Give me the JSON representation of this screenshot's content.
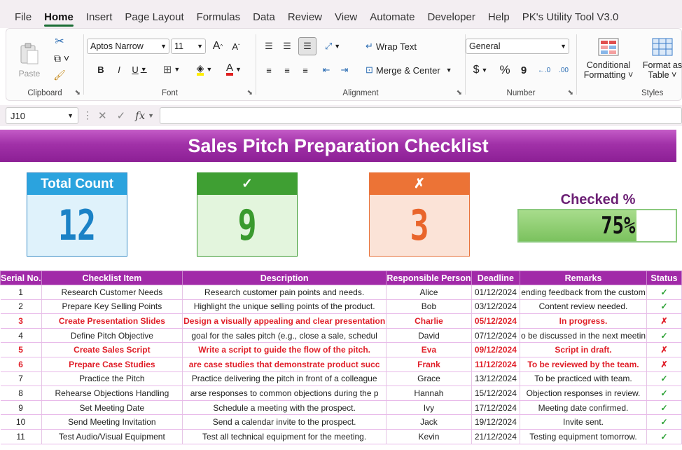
{
  "menu": {
    "tabs": [
      "File",
      "Home",
      "Insert",
      "Page Layout",
      "Formulas",
      "Data",
      "Review",
      "View",
      "Automate",
      "Developer",
      "Help",
      "PK's Utility Tool V3.0"
    ],
    "active": "Home"
  },
  "ribbon": {
    "clipboard": {
      "label": "Clipboard",
      "paste": "Paste"
    },
    "font": {
      "label": "Font",
      "name": "Aptos Narrow",
      "size": "11",
      "bold": "B",
      "italic": "I",
      "underline": "U",
      "grow": "A",
      "shrink": "A"
    },
    "alignment": {
      "label": "Alignment",
      "wrap_text": "Wrap Text",
      "merge_center": "Merge & Center"
    },
    "number": {
      "label": "Number",
      "format": "General",
      "currency": "$",
      "percent": "%",
      "comma": "9"
    },
    "styles": {
      "label": "Styles",
      "conditional": "Conditional",
      "conditional2": "Formatting",
      "format_as": "Format as",
      "format_as2": "Table"
    }
  },
  "formula_bar": {
    "cell_ref": "J10",
    "fx": "fx",
    "value": ""
  },
  "dashboard": {
    "title": "Sales Pitch Preparation Checklist",
    "total_label": "Total Count",
    "total_value": "12",
    "checked_label": "✓",
    "checked_value": "9",
    "unchecked_label": "✗",
    "unchecked_value": "3",
    "pct_label": "Checked %",
    "pct_text": "75%",
    "pct_fraction": 0.75
  },
  "colors": {
    "accent": "#a12aa8",
    "green": "#3f9f33",
    "orange": "#ec7336",
    "blue": "#2ba3de"
  },
  "table": {
    "headers": [
      "Serial No.",
      "Checklist Item",
      "Description",
      "Responsible Person",
      "Deadline",
      "Remarks",
      "Status"
    ],
    "rows": [
      {
        "serial": "1",
        "item": "Research Customer Needs",
        "description": "Research customer pain points and needs.",
        "person": "Alice",
        "deadline": "01/12/2024",
        "remarks": "ending feedback from the custom",
        "status": "✓",
        "checked": true
      },
      {
        "serial": "2",
        "item": "Prepare Key Selling Points",
        "description": "Highlight the unique selling points of the product.",
        "person": "Bob",
        "deadline": "03/12/2024",
        "remarks": "Content review needed.",
        "status": "✓",
        "checked": true
      },
      {
        "serial": "3",
        "item": "Create Presentation Slides",
        "description": "Design a visually appealing and clear presentation",
        "person": "Charlie",
        "deadline": "05/12/2024",
        "remarks": "In progress.",
        "status": "✗",
        "checked": false
      },
      {
        "serial": "4",
        "item": "Define Pitch Objective",
        "description": "goal for the sales pitch (e.g., close a sale, schedul",
        "person": "David",
        "deadline": "07/12/2024",
        "remarks": "o be discussed in the next meetin",
        "status": "✓",
        "checked": true
      },
      {
        "serial": "5",
        "item": "Create Sales Script",
        "description": "Write a script to guide the flow of the pitch.",
        "person": "Eva",
        "deadline": "09/12/2024",
        "remarks": "Script in draft.",
        "status": "✗",
        "checked": false
      },
      {
        "serial": "6",
        "item": "Prepare Case Studies",
        "description": "are case studies that demonstrate product succ",
        "person": "Frank",
        "deadline": "11/12/2024",
        "remarks": "To be reviewed by the team.",
        "status": "✗",
        "checked": false
      },
      {
        "serial": "7",
        "item": "Practice the Pitch",
        "description": "Practice delivering the pitch in front of a colleague",
        "person": "Grace",
        "deadline": "13/12/2024",
        "remarks": "To be practiced with team.",
        "status": "✓",
        "checked": true
      },
      {
        "serial": "8",
        "item": "Rehearse Objections Handling",
        "description": "arse responses to common objections during the p",
        "person": "Hannah",
        "deadline": "15/12/2024",
        "remarks": "Objection responses in review.",
        "status": "✓",
        "checked": true
      },
      {
        "serial": "9",
        "item": "Set Meeting Date",
        "description": "Schedule a meeting with the prospect.",
        "person": "Ivy",
        "deadline": "17/12/2024",
        "remarks": "Meeting date confirmed.",
        "status": "✓",
        "checked": true
      },
      {
        "serial": "10",
        "item": "Send Meeting Invitation",
        "description": "Send a calendar invite to the prospect.",
        "person": "Jack",
        "deadline": "19/12/2024",
        "remarks": "Invite sent.",
        "status": "✓",
        "checked": true
      },
      {
        "serial": "11",
        "item": "Test Audio/Visual Equipment",
        "description": "Test all technical equipment for the meeting.",
        "person": "Kevin",
        "deadline": "21/12/2024",
        "remarks": "Testing equipment tomorrow.",
        "status": "✓",
        "checked": true
      }
    ]
  }
}
